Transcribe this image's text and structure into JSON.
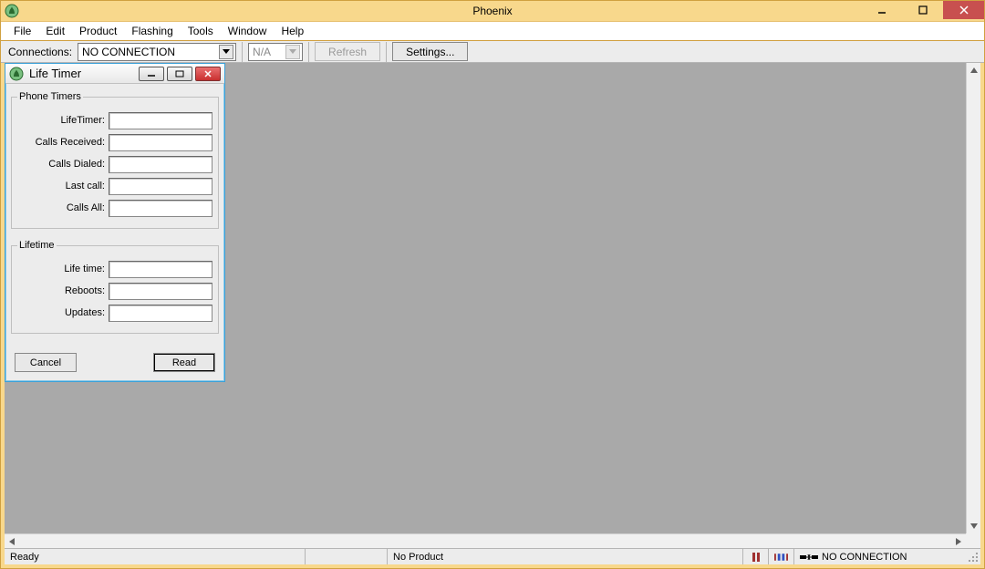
{
  "app": {
    "title": "Phoenix",
    "icon_name": "phoenix-icon"
  },
  "menu": {
    "items": [
      "File",
      "Edit",
      "Product",
      "Flashing",
      "Tools",
      "Window",
      "Help"
    ]
  },
  "toolbar": {
    "connections_label": "Connections:",
    "connections_value": "NO CONNECTION",
    "second_combo_value": "N/A",
    "refresh_label": "Refresh",
    "settings_label": "Settings..."
  },
  "child_window": {
    "title": "Life Timer",
    "phone_timers": {
      "legend": "Phone Timers",
      "fields": [
        {
          "label": "LifeTimer:",
          "value": ""
        },
        {
          "label": "Calls Received:",
          "value": ""
        },
        {
          "label": "Calls Dialed:",
          "value": ""
        },
        {
          "label": "Last call:",
          "value": ""
        },
        {
          "label": "Calls All:",
          "value": ""
        }
      ]
    },
    "lifetime": {
      "legend": "Lifetime",
      "fields": [
        {
          "label": "Life time:",
          "value": ""
        },
        {
          "label": "Reboots:",
          "value": ""
        },
        {
          "label": "Updates:",
          "value": ""
        }
      ]
    },
    "buttons": {
      "cancel": "Cancel",
      "read": "Read"
    }
  },
  "statusbar": {
    "ready": "Ready",
    "product": "No Product",
    "connection": "NO CONNECTION"
  }
}
